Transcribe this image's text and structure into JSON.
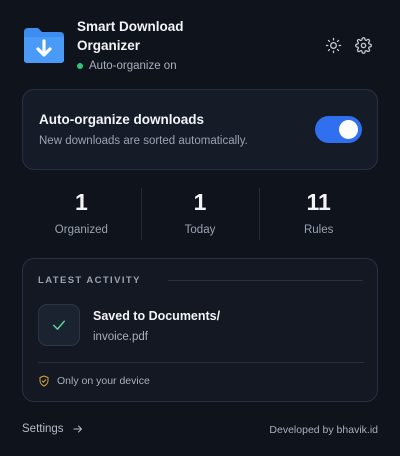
{
  "header": {
    "title": "Smart Download Organizer",
    "status_text": "Auto-organize on",
    "theme_icon": "sun-icon",
    "settings_icon": "gear-icon"
  },
  "toggle_card": {
    "title": "Auto-organize downloads",
    "subtitle": "New downloads are sorted automatically.",
    "enabled": true
  },
  "stats": [
    {
      "value": "1",
      "label": "Organized"
    },
    {
      "value": "1",
      "label": "Today"
    },
    {
      "value": "11",
      "label": "Rules"
    }
  ],
  "activity": {
    "heading": "LATEST ACTIVITY",
    "item_title": "Saved to Documents/",
    "item_file": "invoice.pdf",
    "privacy_text": "Only on your device"
  },
  "footer": {
    "settings_label": "Settings",
    "credit": "Developed by bhavik.id"
  },
  "colors": {
    "accent": "#2f6ff0",
    "status_green": "#2ec77a",
    "background": "#0f131b",
    "card": "#161c27",
    "shield": "#d9a53a",
    "check": "#5fd0a0"
  }
}
